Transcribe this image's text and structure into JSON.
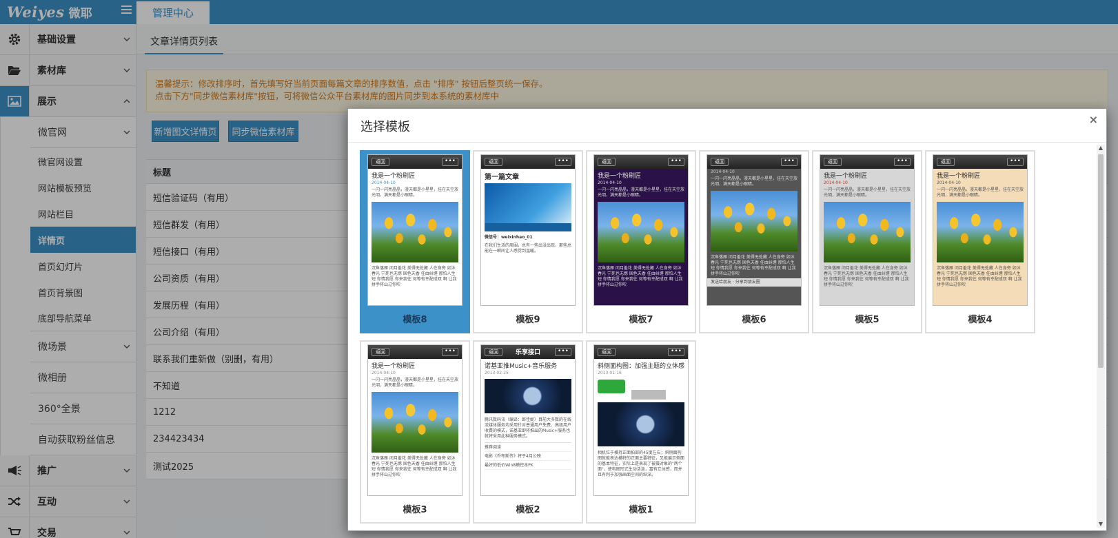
{
  "app": {
    "brand": "Weiyes",
    "brand_cn": "微耶",
    "top_tab": "管理中心"
  },
  "sidebar": {
    "items": [
      {
        "label": "基础设置",
        "icon": "gear-icon"
      },
      {
        "label": "素材库",
        "icon": "folder-open-icon"
      },
      {
        "label": "展示",
        "icon": "image-icon"
      }
    ],
    "show_children": [
      {
        "label": "微官网",
        "type": "group"
      },
      {
        "label": "微官网设置"
      },
      {
        "label": "网站模板预览"
      },
      {
        "label": "网站栏目"
      },
      {
        "label": "详情页",
        "current": true
      },
      {
        "label": "首页幻灯片"
      },
      {
        "label": "首页背景图"
      },
      {
        "label": "底部导航菜单"
      },
      {
        "label": "微场景",
        "type": "group"
      },
      {
        "label": "微相册",
        "type": "plain"
      },
      {
        "label": "360°全景",
        "type": "plain"
      },
      {
        "label": "自动获取粉丝信息",
        "type": "plain"
      }
    ],
    "bottom_items": [
      {
        "label": "推广",
        "icon": "megaphone-icon"
      },
      {
        "label": "互动",
        "icon": "shuffle-icon"
      },
      {
        "label": "交易",
        "icon": "cart-icon"
      }
    ]
  },
  "main": {
    "subtab": "文章详情页列表",
    "notice_line1": "温馨提示：修改排序时，首先填写好当前页面每篇文章的排序数值，点击 \"排序\" 按钮后整页统一保存。",
    "notice_line2": "点击下方\"同步微信素材库\"按钮，可将微信公众平台素材库的图片同步到本系统的素材库中",
    "btn_add": "新增图文详情页",
    "btn_sync": "同步微信素材库",
    "list_header": "标题",
    "rows": [
      "短信验证码（有用）",
      "短信群发（有用）",
      "短信接口（有用）",
      "公司资质（有用）",
      "发展历程（有用）",
      "公司介绍（有用）",
      "联系我们重新做（别删，有用）",
      "不知道",
      "1212",
      "234423434",
      "测试2025"
    ]
  },
  "modal": {
    "title": "选择模板",
    "close": "×",
    "templates": [
      {
        "label": "模板8",
        "selected": true
      },
      {
        "label": "模板9"
      },
      {
        "label": "模板7"
      },
      {
        "label": "模板6"
      },
      {
        "label": "模板5"
      },
      {
        "label": "模板4"
      },
      {
        "label": "模板3"
      },
      {
        "label": "模板2"
      },
      {
        "label": "模板1"
      }
    ],
    "phone": {
      "back": "返回",
      "menu": "•••",
      "pink_title": "我是一个粉刷匠",
      "date1": "2014-04-10",
      "intro": "一闪一闪亮晶晶，漫天都是小星星，挂在天空放光明，满天都是小眼睛。",
      "poem": "沉鱼落雁 闭月羞花 美得无处藏 人在身旁 如沐春光 宁死也无憾 国色天香 任由纠缠 那怕人生短 你情我愿 你来我往 何等有幸配成双 啊 让我拼手将山过你吹",
      "t9_title": "第一篇文章",
      "t9_account": "微信号：weixinhao_01",
      "t9_text": "在我们生活的周围，总有一些出没出现，那些总能在一瞬间让人感觉到温暖。",
      "t7_title": "我是一个粉刷匠",
      "share_friend": "发送给朋友",
      "share_circle": "分享到朋友圈",
      "t2_caption": "乐享接口",
      "t2_title": "诺基亚推Music+音乐服务",
      "t2_date": "2013-02-25",
      "t2_text": "腾讯数码讯（编译：郎佳妮）目前大多数的在线流媒体服务均采用针对普通用户免费、高级用户收费的模式，诺基亚即将推出的Music+服务也就将采用此种服务模式。",
      "t2_rec": "推荐阅读",
      "t2_rec1": "电影《乔布斯传》将于4月公映",
      "t2_rec2": "最好的低价Win8触控本PK",
      "t1_title": "斜侧面构图：加强主题的立体感",
      "t1_date": "2013-01-16",
      "t1_text": "相机位于横持正面拍部的45度左右；斜侧面构图就能表达横特的正面主要特征，又能展示侧面的基本特征，实际上是表现了被摄对象的\"两个面\"，使构图形式生动活泼，富有立体感，而并且有利于加强画面空间的纵深。"
    }
  }
}
